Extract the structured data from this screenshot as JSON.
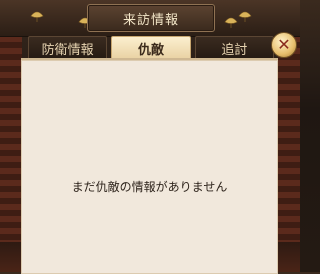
{
  "window": {
    "title": "来訪情報"
  },
  "tabs": [
    {
      "label": "防衛情報",
      "active": false
    },
    {
      "label": "仇敵",
      "active": true
    },
    {
      "label": "追討",
      "active": false
    }
  ],
  "close_button": {
    "icon": "close-icon"
  },
  "content": {
    "empty_message": "まだ仇敵の情報がありません"
  },
  "colors": {
    "accent": "#e9d2a3",
    "panel": "#f1e8dc",
    "frame": "#2b1e15"
  }
}
